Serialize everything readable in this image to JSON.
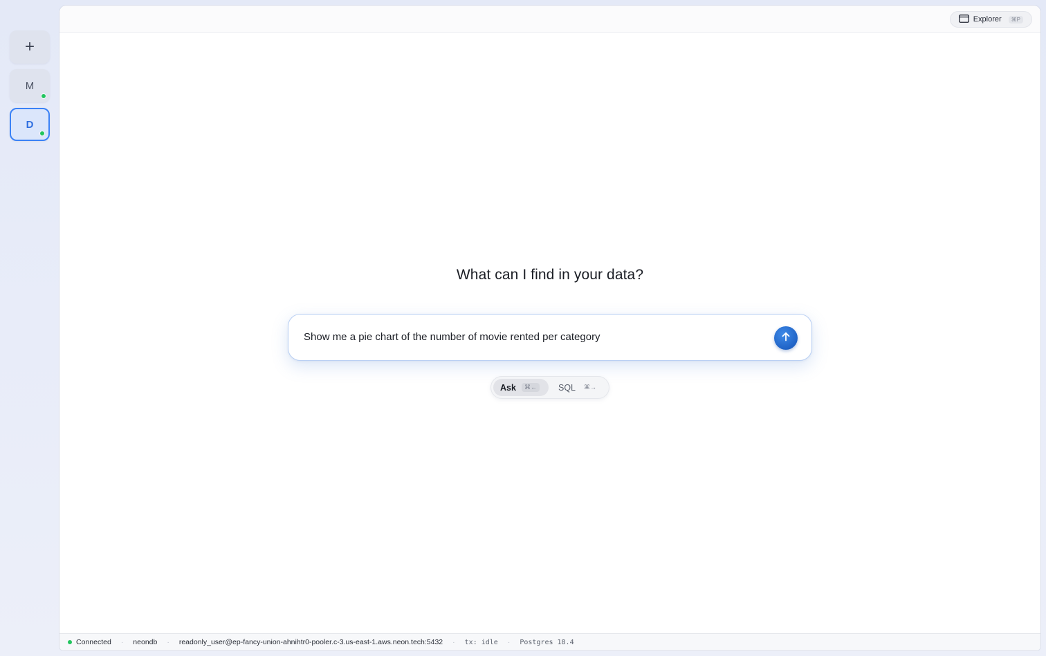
{
  "sidebar": {
    "new_label": "+",
    "connections": [
      {
        "label": "M",
        "status": "connected"
      },
      {
        "label": "D",
        "status": "connected",
        "active": true
      }
    ]
  },
  "topbar": {
    "explorer_label": "Explorer",
    "explorer_shortcut": "⌘P"
  },
  "main": {
    "headline": "What can I find in your data?",
    "query_value": "Show me a pie chart of the number of movie rented per category",
    "send_icon": "arrow-up-icon",
    "modes": [
      {
        "label": "Ask",
        "shortcut": "⌘←",
        "selected": true
      },
      {
        "label": "SQL",
        "shortcut": "⌘→",
        "selected": false
      }
    ]
  },
  "statusbar": {
    "connection_status": "Connected",
    "database": "neondb",
    "host": "readonly_user@ep-fancy-union-ahnihtr0-pooler.c-3.us-east-1.aws.neon.tech:5432",
    "transaction": "tx: idle",
    "engine": "Postgres 18.4"
  },
  "colors": {
    "accent": "#3b82f6",
    "send_button": "#2063c6",
    "connected": "#22c55e"
  }
}
